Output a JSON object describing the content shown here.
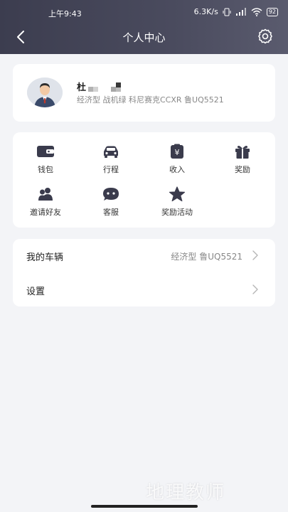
{
  "status_bar": {
    "time": "上午9:43",
    "speed": "6.3K/s",
    "battery": "92"
  },
  "navbar": {
    "title": "个人中心"
  },
  "profile": {
    "name": "杜",
    "subtitle": "经济型 战机绿 科尼赛克CCXR 鲁UQ5521"
  },
  "grid": {
    "items": [
      {
        "label": "钱包",
        "icon": "wallet-icon"
      },
      {
        "label": "行程",
        "icon": "car-icon"
      },
      {
        "label": "收入",
        "icon": "income-icon"
      },
      {
        "label": "奖励",
        "icon": "gift-icon"
      },
      {
        "label": "邀请好友",
        "icon": "invite-friends-icon"
      },
      {
        "label": "客服",
        "icon": "customer-service-icon"
      },
      {
        "label": "奖励活动",
        "icon": "star-icon"
      }
    ]
  },
  "list": {
    "vehicle": {
      "label": "我的车辆",
      "value": "经济型 鲁UQ5521"
    },
    "settings": {
      "label": "设置"
    }
  },
  "watermark": "地理教师",
  "colors": {
    "header": "#3c3d4f",
    "background": "#f3f4f7",
    "icon": "#3a3b4c"
  }
}
